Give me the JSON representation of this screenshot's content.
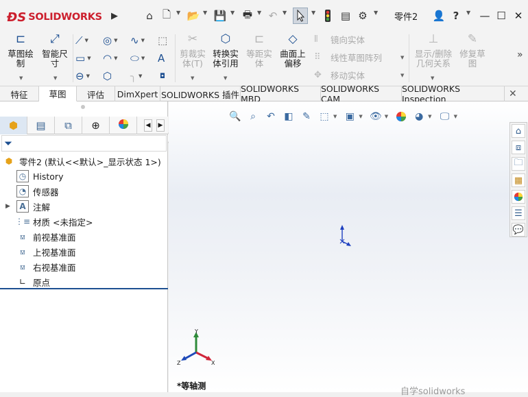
{
  "app": {
    "logo_ds": "ĐS",
    "logo_text": "SOLIDWORKS",
    "document_title": "零件2"
  },
  "ribbon": {
    "sketch": "草图绘\n制",
    "smart_dimension": "智能尺\n寸",
    "trim_entities": "剪裁实\n体(T)",
    "convert_entities": "转换实\n体引用",
    "offset_entities": "等距实\n体",
    "offset_on_surface": "曲面上\n偏移",
    "mirror_entities": "镜向实体",
    "linear_pattern": "线性草图阵列",
    "move_entities": "移动实体",
    "display_delete_relations": "显示/删除\n几何关系",
    "repair_sketch": "修复草\n图"
  },
  "tabs": [
    {
      "label": "特征"
    },
    {
      "label": "草图"
    },
    {
      "label": "评估"
    },
    {
      "label": "DimXpert"
    },
    {
      "label": "SOLIDWORKS 插件"
    },
    {
      "label": "SOLIDWORKS MBD"
    },
    {
      "label": "SOLIDWORKS CAM"
    },
    {
      "label": "SOLIDWORKS Inspection"
    }
  ],
  "active_tab": "草图",
  "tree": {
    "root": "零件2 (默认<<默认>_显示状态 1>)",
    "items": [
      {
        "label": "History"
      },
      {
        "label": "传感器"
      },
      {
        "label": "注解"
      },
      {
        "label": "材质 <未指定>"
      },
      {
        "label": "前视基准面"
      },
      {
        "label": "上视基准面"
      },
      {
        "label": "右视基准面"
      },
      {
        "label": "原点"
      }
    ]
  },
  "viewport": {
    "view_label": "*等轴测",
    "watermark": "自学solidworks",
    "triad_x": "X",
    "triad_y": "Y",
    "triad_z": "Z"
  }
}
